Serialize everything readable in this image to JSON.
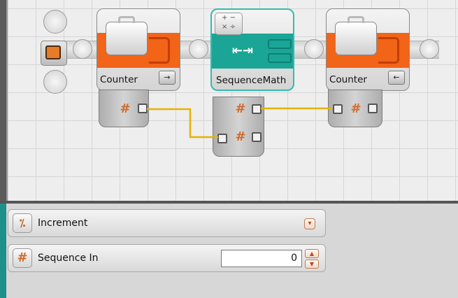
{
  "blocks": {
    "counter_in": {
      "label": "Counter",
      "tail_icon": "arrow-right-icon"
    },
    "sequence_math": {
      "label": "SequenceMath",
      "top_icon": "math-operators-icon",
      "band_icon": "range-arrows-icon"
    },
    "counter_out": {
      "label": "Counter",
      "tail_icon": "arrow-left-icon"
    }
  },
  "hash_symbol": "#",
  "properties": {
    "operation": {
      "label": "Increment",
      "dropdown_glyph": "▾"
    },
    "sequence_in": {
      "label": "Sequence In",
      "value": "0",
      "up": "▲",
      "down": "▼"
    }
  },
  "colors": {
    "orange_band": "#f26418",
    "teal_band": "#1aa596",
    "wire": "#e3b400",
    "accent": "#d06b28"
  }
}
